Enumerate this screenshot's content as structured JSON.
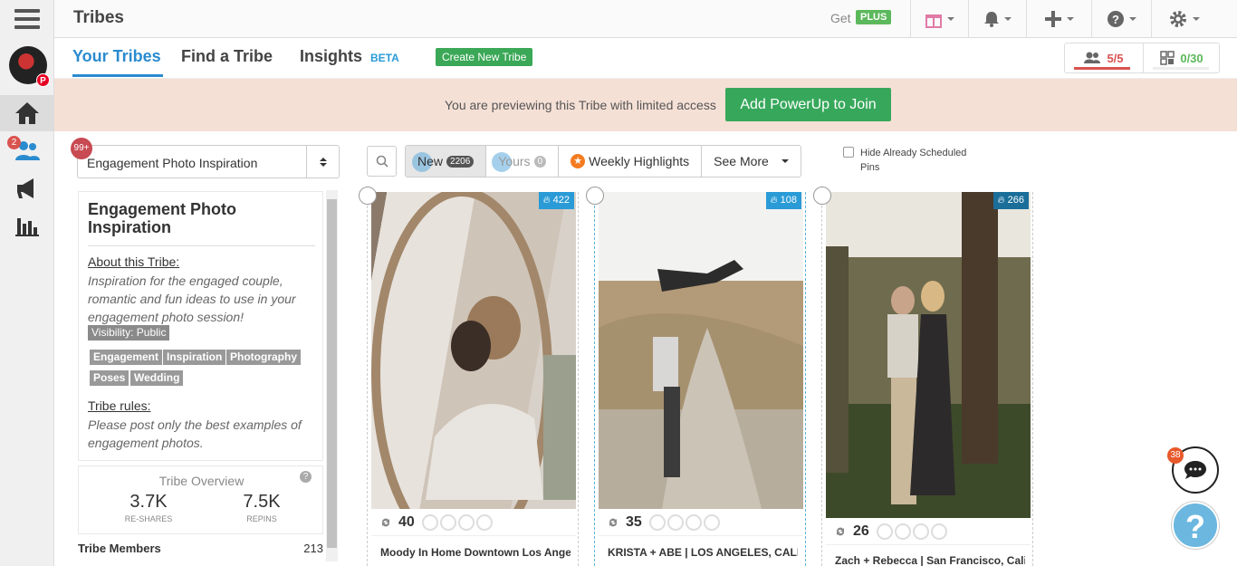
{
  "app": {
    "title": "Tribes"
  },
  "topbar": {
    "get_label": "Get",
    "plus_label": "PLUS"
  },
  "nav": {
    "notification_badge": "2"
  },
  "tabs": [
    {
      "label": "Your Tribes",
      "active": true
    },
    {
      "label": "Find a Tribe",
      "active": false
    },
    {
      "label": "Insights",
      "active": false
    }
  ],
  "insights_badge": "BETA",
  "create_button": "Create New Tribe",
  "meters": {
    "members": {
      "text": "5/5",
      "color": "#d9534f"
    },
    "submissions": {
      "text": "0/30",
      "color": "#5cb85c"
    }
  },
  "banner": {
    "message": "You are previewing this Tribe with limited access",
    "join_button": "Add PowerUp to Join"
  },
  "sidebar": {
    "unread_badge": "99+",
    "selected_tribe": "Engagement Photo Inspiration",
    "card_title": "Engagement Photo Inspiration",
    "about_label": "About this Tribe:",
    "about_text": "Inspiration for the engaged couple, romantic and fun ideas to use in your engagement photo session!",
    "visibility": "Visibility: Public",
    "tags": [
      "Engagement",
      "Inspiration",
      "Photography",
      "Poses",
      "Wedding"
    ],
    "rules_label": "Tribe rules:",
    "rules_text": "Please post only the best examples of engagement photos.",
    "overview_title": "Tribe Overview",
    "stats": [
      {
        "value": "3.7K",
        "label": "RE-SHARES"
      },
      {
        "value": "7.5K",
        "label": "REPINS"
      }
    ],
    "members_label": "Tribe Members",
    "members_count": "213"
  },
  "filters": {
    "new_label": "New",
    "new_count": "2206",
    "yours_label": "Yours",
    "yours_count": "0",
    "highlights_label": "Weekly Highlights",
    "see_more_label": "See More",
    "hide_label": "Hide Already Scheduled Pins"
  },
  "pins": [
    {
      "heat": "422",
      "count": "40",
      "caption": "Moody In Home Downtown Los Angeles",
      "image_color": "#c8bfb4"
    },
    {
      "heat": "108",
      "count": "35",
      "caption": "KRISTA + ABE | LOS ANGELES, CALIFORNIA",
      "image_color": "#a89a86"
    },
    {
      "heat": "266",
      "count": "26",
      "caption": "Zach + Rebecca | San Francisco, California",
      "image_color": "#5a5a3e"
    }
  ],
  "chat_badge": "38",
  "help_label": "?"
}
